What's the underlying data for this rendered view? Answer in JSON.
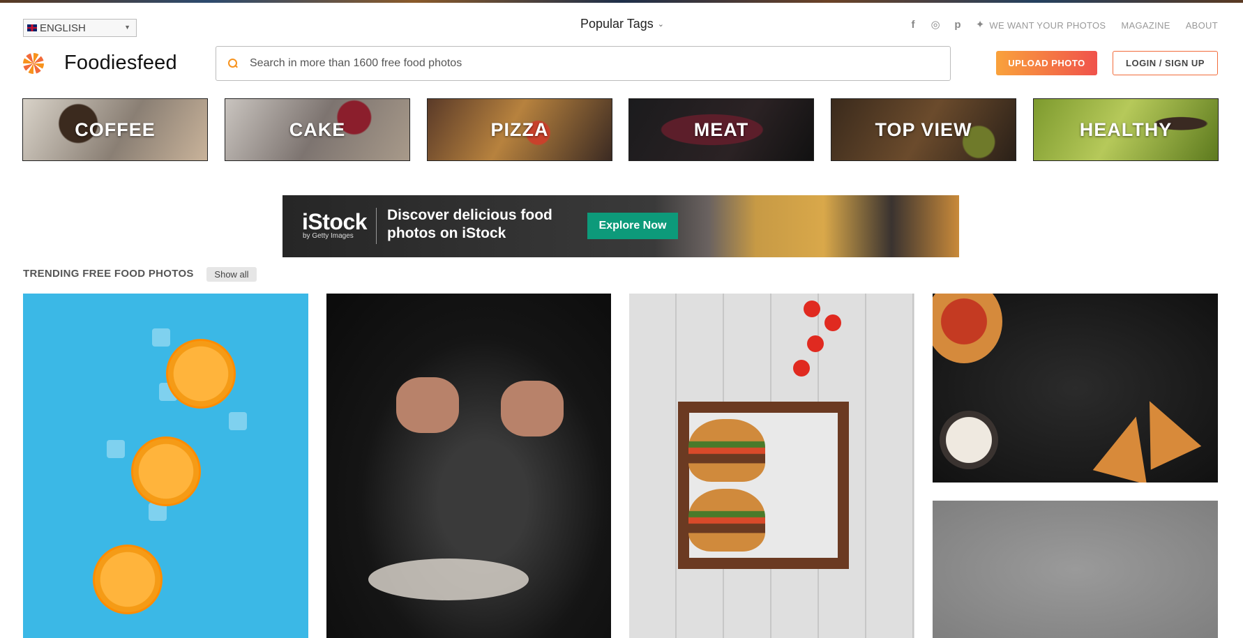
{
  "header": {
    "language": "ENGLISH",
    "popular_tags": "Popular Tags",
    "social_icons": [
      "facebook-icon",
      "instagram-icon",
      "pinterest-icon",
      "twitter-icon"
    ],
    "links": [
      "WE WANT YOUR PHOTOS",
      "MAGAZINE",
      "ABOUT"
    ]
  },
  "brand": {
    "name": "Foodiesfeed"
  },
  "search": {
    "placeholder": "Search in more than 1600 free food photos",
    "value": ""
  },
  "actions": {
    "upload": "UPLOAD PHOTO",
    "login": "LOGIN / SIGN UP"
  },
  "categories": [
    "COFFEE",
    "CAKE",
    "PIZZA",
    "MEAT",
    "TOP VIEW",
    "HEALTHY"
  ],
  "banner": {
    "logo": "iStock",
    "sublogo": "by Getty Images",
    "headline": "Discover delicious food photos on iStock",
    "cta": "Explore Now"
  },
  "trending": {
    "title": "TRENDING FREE FOOD PHOTOS",
    "show_all": "Show all"
  },
  "colors": {
    "accent": "#f7931e",
    "accent_red": "#f0524b",
    "cta_green": "#0d9a7a"
  }
}
